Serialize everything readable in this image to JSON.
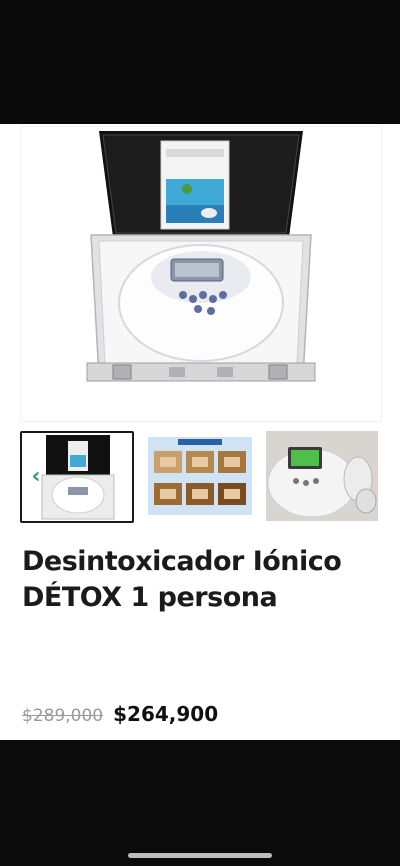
{
  "product": {
    "title": "Desintoxicador Iónico DÉTOX 1 persona",
    "old_price": "$289,000",
    "price": "$264,900"
  },
  "gallery": {
    "prev_arrow": "‹",
    "thumbnails": [
      "detox-case",
      "foot-bath-chart",
      "device-closeup"
    ]
  },
  "colors": {
    "accent": "#2aa06a",
    "device_screen": "#8a96a8",
    "device_buttons": "#5b6fa0"
  }
}
